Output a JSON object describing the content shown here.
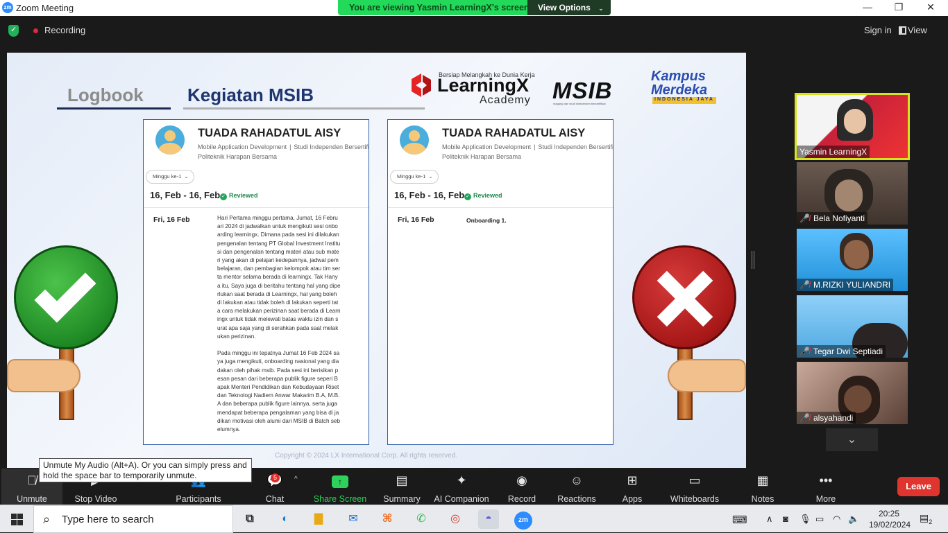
{
  "window": {
    "title": "Zoom Meeting",
    "app_icon": "zm",
    "minimize": "—",
    "maximize": "❐",
    "close": "✕"
  },
  "banner": {
    "message": "You are viewing Yasmin LearningX's screen",
    "view_options": "View Options"
  },
  "topbar": {
    "recording": "Recording",
    "sign_in": "Sign in",
    "view": "View"
  },
  "slide": {
    "tab_logbook": "Logbook",
    "tab_kegiatan": "Kegiatan MSIB",
    "learningx_tagline": "Bersiap Melangkah ke Dunia Kerja",
    "learningx_name": "LearningX",
    "learningx_academy": "Academy",
    "msib_logo": "MSIB",
    "msib_tagline": "magang dan studi independen bersertifikat",
    "km_line1": "Kampus",
    "km_line2": "Merdeka",
    "km_line3": "INDONESIA JAYA",
    "copyright": "Copyright © 2024 LX International Corp. All rights reserved.",
    "cards": [
      {
        "name": "TUADA RAHADATUL AISY",
        "program": "Mobile Application Development",
        "program_type": "Studi Independen Bersertifi",
        "school": "Politeknik Harapan Bersama",
        "week": "Minggu ke-1",
        "date_range": "16, Feb - 16, Feb",
        "status": "Reviewed",
        "day": "Fri, 16 Feb",
        "body": "Hari Pertama minggu pertama, Jumat, 16 Februari 2024 di jadwalkan untuk mengikuti sesi onboarding learningx. Dimana pada sesi ini dilakukan pengenalan tentang PT Global Investment Institusi dan pengenalan tentang materi atau sub materi yang akan di pelajari kedepannya, jadwal pembelajaran, dan pembagian kelompok atau tim serta mentor selama berada di learningx. Tak Hanya itu, Saya juga di beritahu tentang hal yang diperlukan saat berada di Learningx, hal yang boleh di lakukan atau tidak boleh di lakukan seperti tata cara melakukan perizinan saat berada di Learningx untuk tidak melewati batas waktu izin dan surat apa saja yang di serahkan pada saat melakukan perizinan.\n\nPada minggu ini tepatnya Jumat 16 Feb 2024 saya juga mengikuti, onboarding nasional yang diadakan oleh pihak msib. Pada sesi ini berisikan pesan pesan dari beberapa publik figure seperi Bapak Menteri Pendidikan dan Kebudayaan Riset dan Teknologi Nadiem Anwar Makarim B.A, M.B.A dan beberapa publik figure lainnya, serta juga mendapat beberapa pengalaman yang bisa di jadikan motivasi oleh alumi dari MSIB di Batch sebelumnya."
      },
      {
        "name": "TUADA RAHADATUL AISY",
        "program": "Mobile Application Development",
        "program_type": "Studi Independen Bersertifi",
        "school": "Politeknik Harapan Bersama",
        "week": "Minggu ke-1",
        "date_range": "16, Feb - 16, Feb",
        "status": "Reviewed",
        "day": "Fri, 16 Feb",
        "body": "Onboarding 1."
      }
    ]
  },
  "participants": [
    {
      "name": "Yasmin LearningX",
      "muted": false,
      "active": true,
      "bg": "#c8213a"
    },
    {
      "name": "Bela Nofiyanti",
      "muted": true,
      "active": false,
      "bg": "#5a4a40"
    },
    {
      "name": "M.RIZKI YULIANDRI",
      "muted": true,
      "active": false,
      "bg": "#2e9be0"
    },
    {
      "name": "Tegar Dwi Septiadi",
      "muted": true,
      "active": false,
      "bg": "#6fb8e8"
    },
    {
      "name": "alsyahandi",
      "muted": true,
      "active": false,
      "bg": "#8a6a5a"
    }
  ],
  "tooltip": "Unmute My Audio (Alt+A). Or you can simply press and hold the space bar to temporarily unmute.",
  "toolbar": {
    "unmute": "Unmute",
    "stop_video": "Stop Video",
    "participants": "Participants",
    "chat": "Chat",
    "chat_badge": "5",
    "share_screen": "Share Screen",
    "summary": "Summary",
    "ai_companion": "AI Companion",
    "record": "Record",
    "reactions": "Reactions",
    "apps": "Apps",
    "whiteboards": "Whiteboards",
    "notes": "Notes",
    "more": "More",
    "leave": "Leave"
  },
  "taskbar": {
    "search_placeholder": "Type here to search",
    "time": "20:25",
    "date": "19/02/2024",
    "notifications": "2"
  },
  "colors": {
    "zoom_blue": "#2d8cff",
    "share_green": "#23d959",
    "leave_red": "#e0352e",
    "active_speaker": "#d9e21a"
  }
}
